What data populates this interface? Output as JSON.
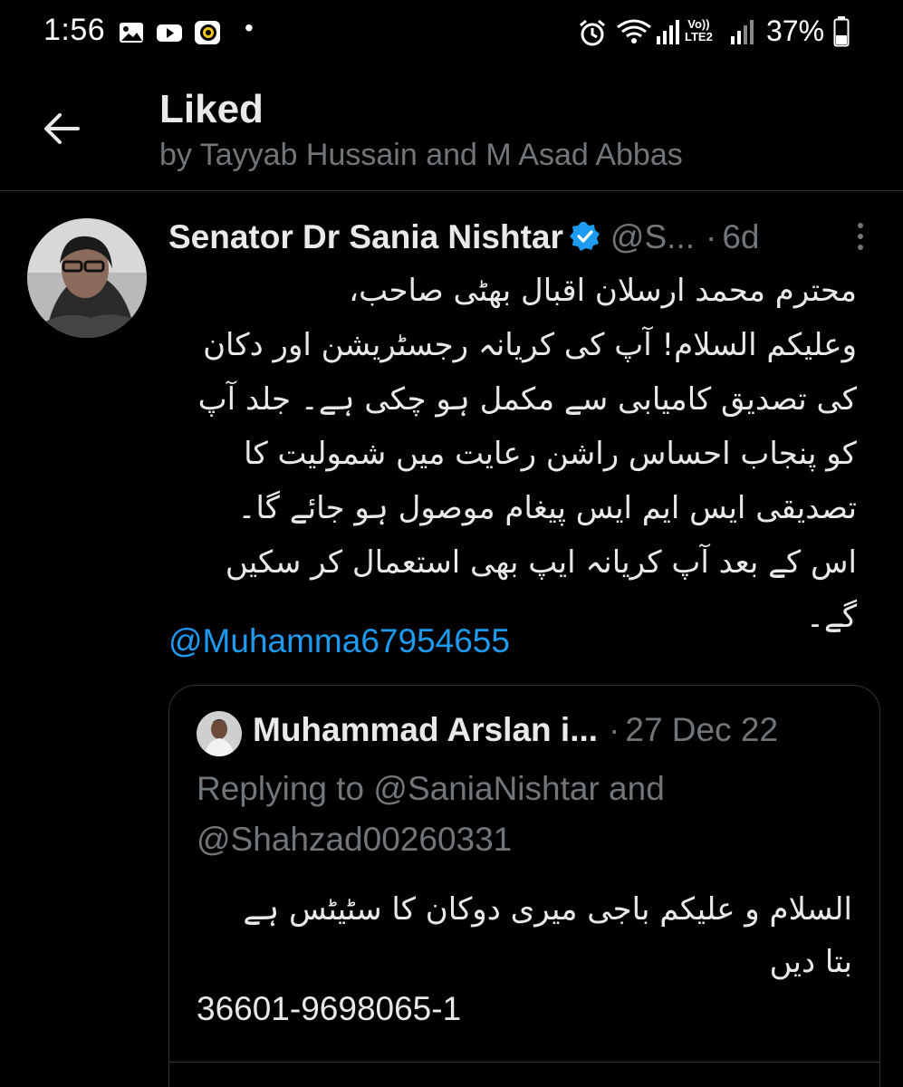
{
  "status_bar": {
    "time": "1:56",
    "dot": "•",
    "network_label_top": "Vo))",
    "network_label_bottom": "LTE2",
    "battery": "37%",
    "icons": [
      "gallery-icon",
      "youtube-icon",
      "app-icon",
      "alarm-icon",
      "wifi-icon",
      "signal-icon",
      "battery-icon"
    ]
  },
  "header": {
    "title": "Liked",
    "subtitle": "by Tayyab Hussain and M Asad Abbas",
    "back_icon": "arrow-left-icon"
  },
  "tweet": {
    "author_name": "Senator Dr Sania Nishtar",
    "handle": "@S...",
    "separator": "·",
    "time": "6d",
    "body_lines": [
      "محترم محمد ارسلان اقبال بھٹی صاحب،",
      "وعلیکم السلام! آپ کی کریانہ رجسٹریشن اور دکان",
      "کی تصدیق کامیابی سے مکمل ہو چکی ہے۔ جلد آپ",
      "کو پنجاب احساس راشن رعایت میں شمولیت کا",
      "تصدیقی ایس ایم ایس پیغام موصول ہو جائے گا۔",
      "اس کے بعد آپ کریانہ ایپ بھی استعمال کر سکیں",
      "گے۔"
    ],
    "mention": "@Muhamma67954655",
    "quoted": {
      "author_name": "Muhammad Arslan i...",
      "separator": "·",
      "date": "27 Dec 22",
      "replying_line1": "Replying to @SaniaNishtar and",
      "replying_line2": "@Shahzad00260331",
      "body_lines": [
        "السلام و علیکم باجی میری دوکان کا سٹیٹس ہے",
        "بتا دیں"
      ],
      "number": "36601-9698065-1"
    }
  },
  "colors": {
    "background": "#000000",
    "text": "#e7e9ea",
    "muted": "#71767b",
    "link": "#1d9bf0",
    "border": "#2f3336"
  }
}
